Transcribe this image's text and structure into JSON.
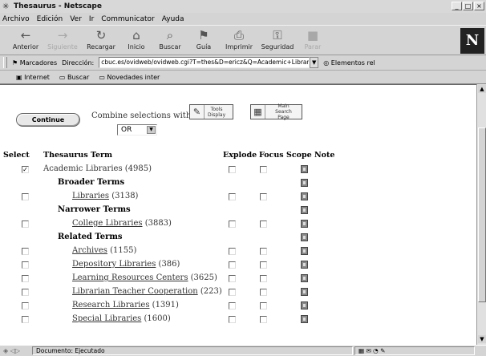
{
  "window": {
    "title": "Thesaurus - Netscape",
    "controls": [
      "_",
      "□",
      "×"
    ]
  },
  "menu": [
    "Archivo",
    "Edición",
    "Ver",
    "Ir",
    "Communicator",
    "Ayuda"
  ],
  "nav": [
    {
      "label": "Anterior",
      "icon": "back-icon",
      "glyph": "←",
      "enabled": true
    },
    {
      "label": "Siguiente",
      "icon": "forward-icon",
      "glyph": "→",
      "enabled": false
    },
    {
      "label": "Recargar",
      "icon": "reload-icon",
      "glyph": "↻",
      "enabled": true
    },
    {
      "label": "Inicio",
      "icon": "home-icon",
      "glyph": "⌂",
      "enabled": true
    },
    {
      "label": "Buscar",
      "icon": "search-icon",
      "glyph": "⌕",
      "enabled": true
    },
    {
      "label": "Guía",
      "icon": "guide-icon",
      "glyph": "⚑",
      "enabled": true
    },
    {
      "label": "Imprimir",
      "icon": "print-icon",
      "glyph": "⎙",
      "enabled": true
    },
    {
      "label": "Seguridad",
      "icon": "security-icon",
      "glyph": "⚿",
      "enabled": true
    },
    {
      "label": "Parar",
      "icon": "stop-icon",
      "glyph": "■",
      "enabled": false
    }
  ],
  "logo": "N",
  "location": {
    "bookmarks_label": "Marcadores",
    "address_label": "Dirección:",
    "url": "cbuc.es/ovidweb/ovidweb.cgi?T=thes&D=ericz&Q=Academic+Libraries&S=ODOGACIDBDEOKN",
    "related_label": "Elementos rel"
  },
  "personal": [
    "Internet",
    "Buscar",
    "Novedades inter"
  ],
  "form": {
    "continue_label": "Continue",
    "combine_label": "Combine selections with:",
    "combine_value": "OR",
    "tools_label_1": "Tools",
    "tools_label_2": "Display",
    "main_label_1": "Main",
    "main_label_2": "Search Page"
  },
  "table": {
    "headers": {
      "select": "Select",
      "term": "Thesaurus Term",
      "explode": "Explode",
      "focus": "Focus",
      "scope": "Scope Note"
    },
    "academic": {
      "term": "Academic Libraries",
      "count": "(4985)",
      "checked": true
    },
    "sections": {
      "broader": "Broader Terms",
      "narrower": "Narrower Terms",
      "related": "Related Terms"
    },
    "broader": [
      {
        "term": "Libraries",
        "count": "(3138)"
      }
    ],
    "narrower": [
      {
        "term": "College Libraries",
        "count": "(3883)"
      }
    ],
    "related": [
      {
        "term": "Archives",
        "count": "(1155)"
      },
      {
        "term": "Depository Libraries",
        "count": "(386)"
      },
      {
        "term": "Learning Resources Centers",
        "count": "(3625)"
      },
      {
        "term": "Librarian Teacher Cooperation",
        "count": "(223)"
      },
      {
        "term": "Research Libraries",
        "count": "(1391)"
      },
      {
        "term": "Special Libraries",
        "count": "(1600)"
      }
    ]
  },
  "status": {
    "text": "Documento: Ejecutado"
  }
}
